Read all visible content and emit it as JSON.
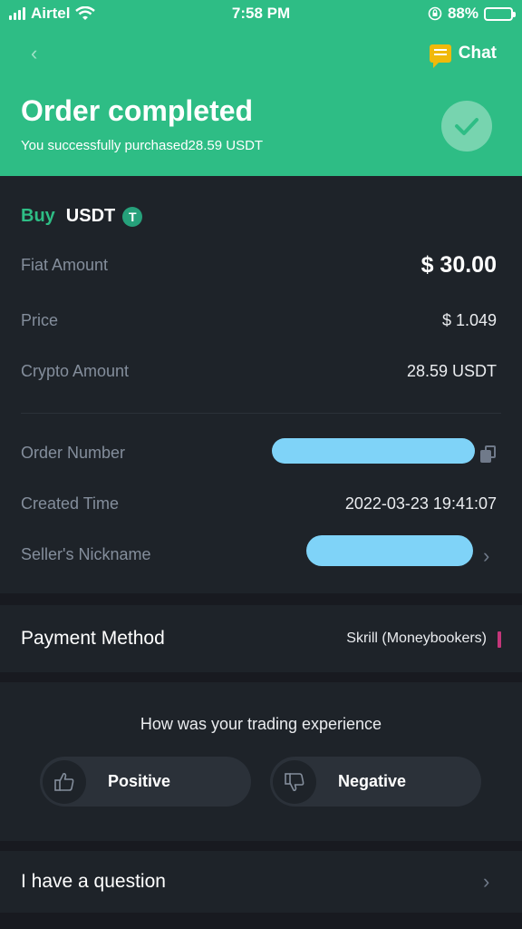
{
  "status_bar": {
    "carrier": "Airtel",
    "time": "7:58 PM",
    "battery": "88%",
    "battery_level": 0.88
  },
  "header": {
    "back_icon": "back-arrow-icon",
    "chat_label": "Chat",
    "title": "Order completed",
    "subtitle": "You successfully purchased28.59 USDT",
    "check_icon": "checkmark-icon"
  },
  "order": {
    "side": "Buy",
    "asset": "USDT",
    "asset_icon": "T",
    "fiat_amount_label": "Fiat Amount",
    "fiat_amount": "$ 30.00",
    "price_label": "Price",
    "price": "$ 1.049",
    "crypto_amount_label": "Crypto Amount",
    "crypto_amount": "28.59 USDT",
    "order_number_label": "Order Number",
    "created_time_label": "Created Time",
    "created_time": "2022-03-23 19:41:07",
    "seller_label": "Seller's Nickname"
  },
  "payment": {
    "label": "Payment Method",
    "value": "Skrill (Moneybookers)",
    "accent_color": "#c4367a"
  },
  "feedback": {
    "question": "How was your trading experience",
    "positive": "Positive",
    "negative": "Negative"
  },
  "question": {
    "label": "I have a question"
  },
  "colors": {
    "accent_green": "#2ebd85",
    "background": "#181a20",
    "card": "#1e2329",
    "redaction": "#7fd3f8"
  }
}
